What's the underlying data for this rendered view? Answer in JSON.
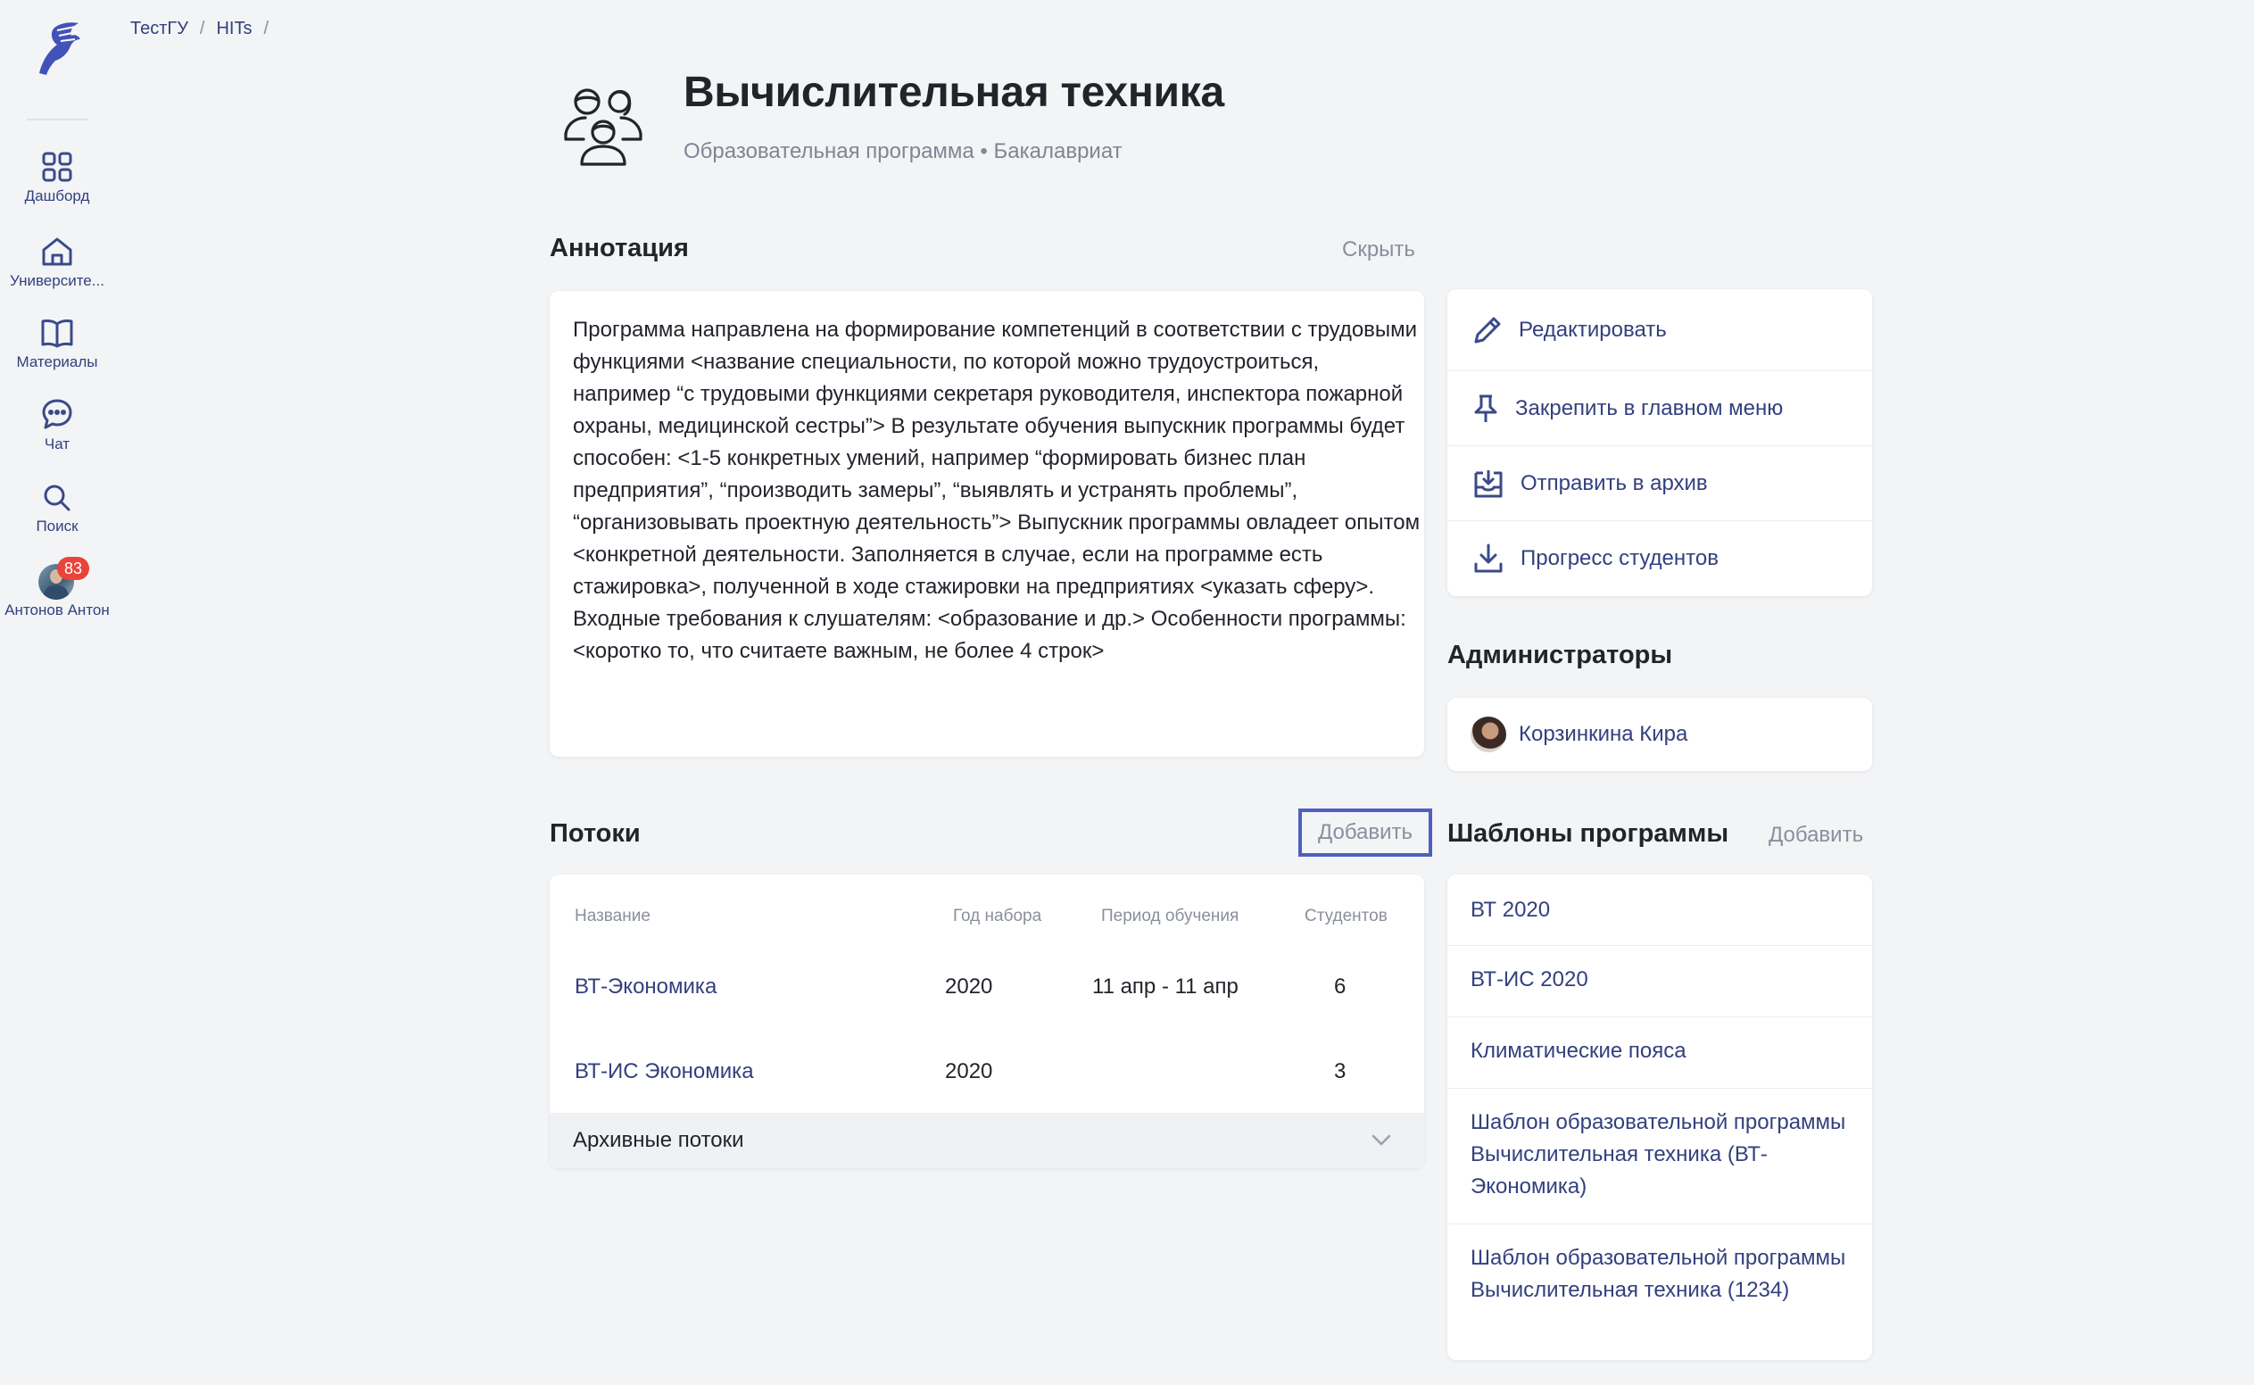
{
  "sidebar": {
    "items": [
      {
        "label": "Дашборд",
        "icon": "dashboard-icon"
      },
      {
        "label": "Университе...",
        "icon": "university-icon"
      },
      {
        "label": "Материалы",
        "icon": "book-icon"
      },
      {
        "label": "Чат",
        "icon": "chat-icon"
      },
      {
        "label": "Поиск",
        "icon": "search-icon"
      }
    ],
    "user": {
      "name": "Антонов Антон",
      "badge": "83"
    }
  },
  "breadcrumb": {
    "items": [
      "ТестГУ",
      "HITs"
    ],
    "separator": "/"
  },
  "header": {
    "title": "Вычислительная техника",
    "subtitle": "Образовательная программа • Бакалавриат"
  },
  "annotation": {
    "title": "Аннотация",
    "hide_label": "Скрыть",
    "text": "Программа направлена на формирование компетенций в соответствии с трудовыми функциями <название специальности, по которой можно трудоустроиться, например “с трудовыми функциями секретаря руководителя, инспектора пожарной охраны, медицинской сестры”> В результате обучения выпускник программы будет способен: <1-5 конкретных умений, например “формировать бизнес план предприятия”, “производить замеры”, “выявлять и устранять проблемы”, “организовывать проектную деятельность”> Выпускник программы овладеет опытом <конкретной деятельности. Заполняется в случае, если на программе есть стажировка>, полученной в ходе стажировки на предприятиях <указать сферу>. Входные требования к слушателям: <образование и др.> Особенности программы: <коротко то, что считаете важным, не более 4 строк>"
  },
  "actions": {
    "edit": "Редактировать",
    "pin": "Закрепить в главном меню",
    "archive": "Отправить в архив",
    "progress": "Прогресс студентов"
  },
  "admins": {
    "title": "Администраторы",
    "list": [
      {
        "name": "Корзинкина Кира"
      }
    ]
  },
  "streams": {
    "title": "Потоки",
    "add_label": "Добавить",
    "columns": [
      "Название",
      "Год набора",
      "Период обучения",
      "Студентов"
    ],
    "rows": [
      {
        "name": "ВТ-Экономика",
        "year": "2020",
        "period": "11 апр - 11 апр",
        "students": "6"
      },
      {
        "name": "ВТ-ИС Экономика",
        "year": "2020",
        "period": "",
        "students": "3"
      }
    ],
    "archive_label": "Архивные потоки"
  },
  "templates": {
    "title": "Шаблоны программы",
    "add_label": "Добавить",
    "items": [
      "ВТ 2020",
      "ВТ-ИС 2020",
      "Климатические пояса",
      "Шаблон образовательной программы Вычислительная техника (ВТ-Экономика)",
      "Шаблон образовательной программы Вычислительная техника (1234)"
    ]
  },
  "colors": {
    "accent": "#33407f",
    "muted": "#8a8f9c",
    "badge": "#e8443a",
    "focus": "#4e5fc0",
    "background": "#f3f4f6"
  }
}
